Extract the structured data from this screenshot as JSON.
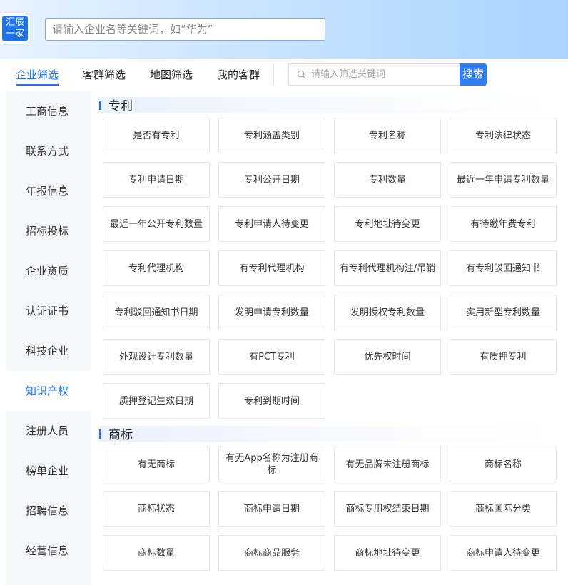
{
  "logo": {
    "line1": "汇辰",
    "line2": "一家"
  },
  "header": {
    "search_placeholder": "请输入企业名等关键词，如“华为”"
  },
  "tabs": [
    "企业筛选",
    "客群筛选",
    "地图筛选",
    "我的客群"
  ],
  "filter_search": {
    "placeholder": "请输入筛选关键词",
    "button": "搜索"
  },
  "sidebar": [
    "工商信息",
    "联系方式",
    "年报信息",
    "招标投标",
    "企业资质",
    "认证证书",
    "科技企业",
    "知识产权",
    "注册人员",
    "榜单企业",
    "招聘信息",
    "经营信息"
  ],
  "sidebar_active": "知识产权",
  "sections": [
    {
      "title": "专利",
      "items": [
        "是否有专利",
        "专利涵盖类别",
        "专利名称",
        "专利法律状态",
        "专利申请日期",
        "专利公开日期",
        "专利数量",
        "最近一年申请专利数量",
        "最近一年公开专利数量",
        "专利申请人待变更",
        "专利地址待变更",
        "有待缴年费专利",
        "专利代理机构",
        "有专利代理机构",
        "有专利代理机构注/吊销",
        "有专利驳回通知书",
        "专利驳回通知书日期",
        "发明申请专利数量",
        "发明授权专利数量",
        "实用新型专利数量",
        "外观设计专利数量",
        "有PCT专利",
        "优先权时间",
        "有质押专利",
        "质押登记生效日期",
        "专利到期时间"
      ]
    },
    {
      "title": "商标",
      "items": [
        "有无商标",
        "有无App名称为注册商标",
        "有无品牌未注册商标",
        "商标名称",
        "商标状态",
        "商标申请日期",
        "商标专用权结束日期",
        "商标国际分类",
        "商标数量",
        "商标商品服务",
        "商标地址待变更",
        "商标申请人待变更"
      ]
    }
  ],
  "colors": {
    "accent": "#1f73e8",
    "search_button": "#2f7ff0"
  }
}
